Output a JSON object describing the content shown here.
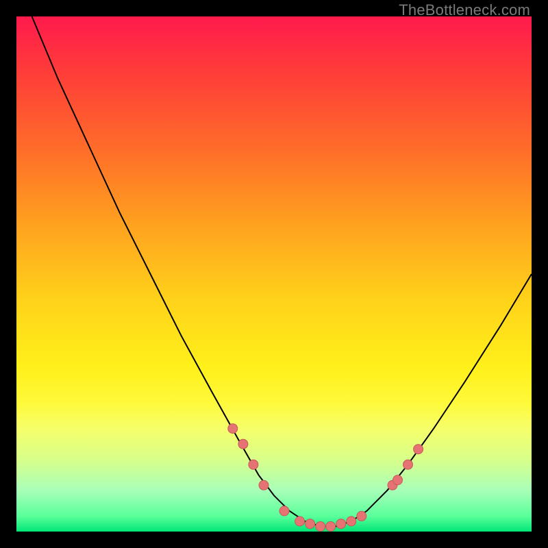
{
  "watermark": "TheBottleneck.com",
  "colors": {
    "curve": "#000000",
    "marker_fill": "#e57373",
    "marker_stroke": "#c85a5a"
  },
  "chart_data": {
    "type": "line",
    "title": "",
    "xlabel": "",
    "ylabel": "",
    "xlim": [
      0,
      100
    ],
    "ylim": [
      0,
      100
    ],
    "grid": false,
    "legend": false,
    "series": [
      {
        "name": "bottleneck-curve",
        "x": [
          3,
          8,
          14,
          20,
          26,
          32,
          38,
          43,
          47,
          50,
          53,
          56,
          59,
          62,
          65,
          68,
          72,
          76,
          81,
          87,
          94,
          100
        ],
        "y": [
          100,
          88,
          75,
          62,
          50,
          38,
          27,
          18,
          11,
          7,
          4,
          2,
          1,
          1,
          2,
          4,
          8,
          13,
          20,
          29,
          40,
          50
        ]
      }
    ],
    "markers": {
      "name": "highlight-points",
      "x": [
        42,
        44,
        46,
        48,
        52,
        55,
        57,
        59,
        61,
        63,
        65,
        67,
        73,
        74,
        76,
        78
      ],
      "y": [
        20,
        17,
        13,
        9,
        4,
        2,
        1.5,
        1,
        1,
        1.5,
        2,
        3,
        9,
        10,
        13,
        16
      ]
    }
  }
}
